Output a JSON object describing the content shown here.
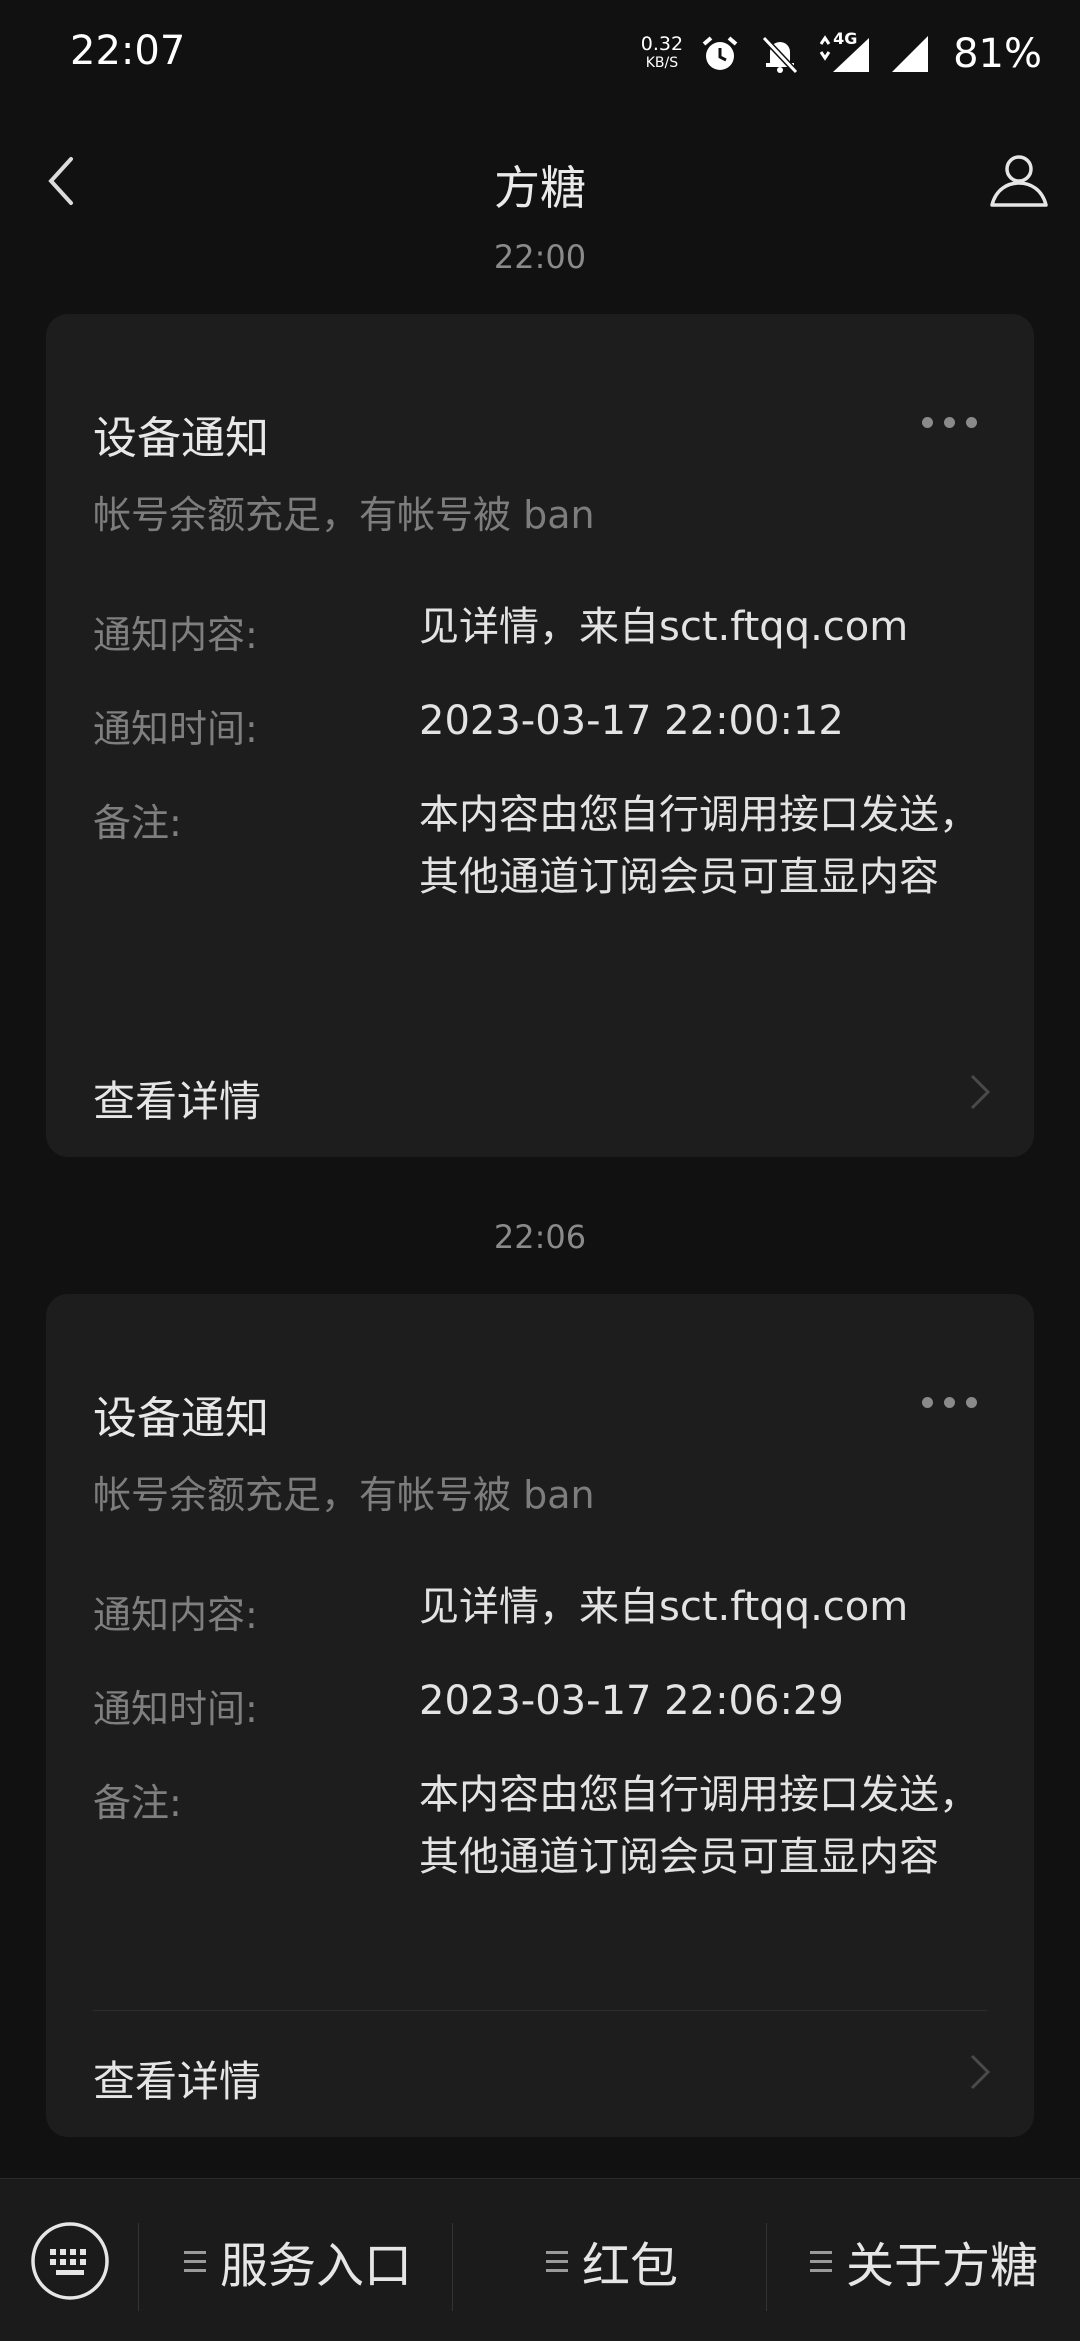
{
  "status_bar": {
    "time": "22:07",
    "net_speed_value": "0.32",
    "net_speed_unit": "KB/S",
    "network": "4G",
    "battery": "81%"
  },
  "header": {
    "title": "方糖"
  },
  "timestamps": {
    "top_partial": "22:00",
    "second": "22:06"
  },
  "cards": [
    {
      "title": "设备通知",
      "subtitle": "帐号余额充足，有帐号被 ban",
      "rows": [
        {
          "label": "通知内容:",
          "value": "见详情，来自sct.ftqq.com"
        },
        {
          "label": "通知时间:",
          "value": "2023-03-17 22:00:12"
        },
        {
          "label": "备注:",
          "value": "本内容由您自行调用接口发送，其他通道订阅会员可直显内容"
        }
      ],
      "detail_link": "查看详情"
    },
    {
      "title": "设备通知",
      "subtitle": "帐号余额充足，有帐号被 ban",
      "rows": [
        {
          "label": "通知内容:",
          "value": "见详情，来自sct.ftqq.com"
        },
        {
          "label": "通知时间:",
          "value": "2023-03-17 22:06:29"
        },
        {
          "label": "备注:",
          "value": "本内容由您自行调用接口发送，其他通道订阅会员可直显内容"
        }
      ],
      "detail_link": "查看详情"
    }
  ],
  "bottom_menu": {
    "keyboard_icon": "keyboard-icon",
    "items": [
      {
        "label": "服务入口"
      },
      {
        "label": "红包"
      },
      {
        "label": "关于方糖"
      }
    ]
  },
  "colors": {
    "background": "#111111",
    "card": "#1d1d1d",
    "bottom_bar": "#1b1b1b",
    "muted_text": "#7f7f7f"
  }
}
